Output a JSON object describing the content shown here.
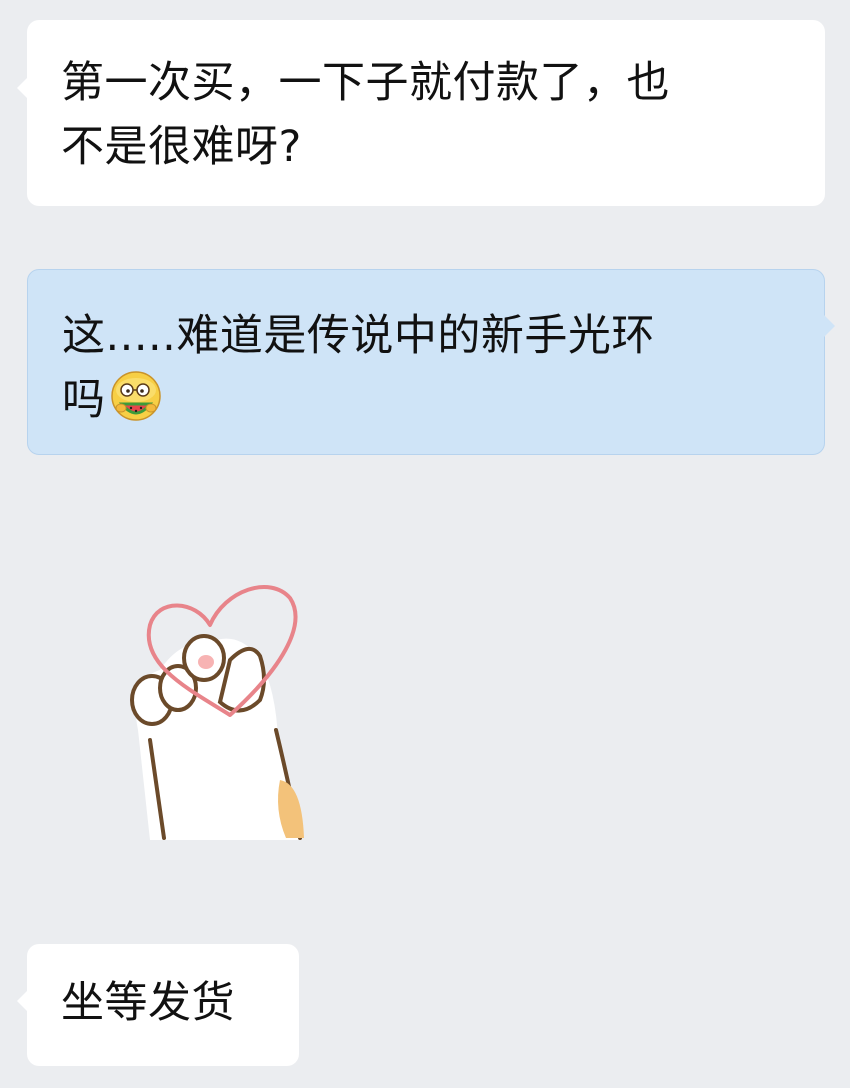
{
  "messages": [
    {
      "id": "msg1",
      "side": "left",
      "line1": "第一次买，一下子就付款了，也",
      "line2": "不是很难呀?"
    },
    {
      "id": "msg2",
      "side": "right",
      "line1": "这.....难道是传说中的新手光环",
      "line2": "吗",
      "emoji": "watermelon-eating-face-emoji"
    },
    {
      "id": "msg3",
      "side": "left",
      "sticker": "paw-holding-heart-sticker"
    },
    {
      "id": "msg4",
      "side": "left",
      "text": "坐等发货"
    }
  ],
  "colors": {
    "background": "#ebedf0",
    "bubble_left": "#ffffff",
    "bubble_right": "#cfe4f7",
    "text": "#111111",
    "heart": "#e8848a",
    "paw_outline": "#6b4a2a"
  }
}
